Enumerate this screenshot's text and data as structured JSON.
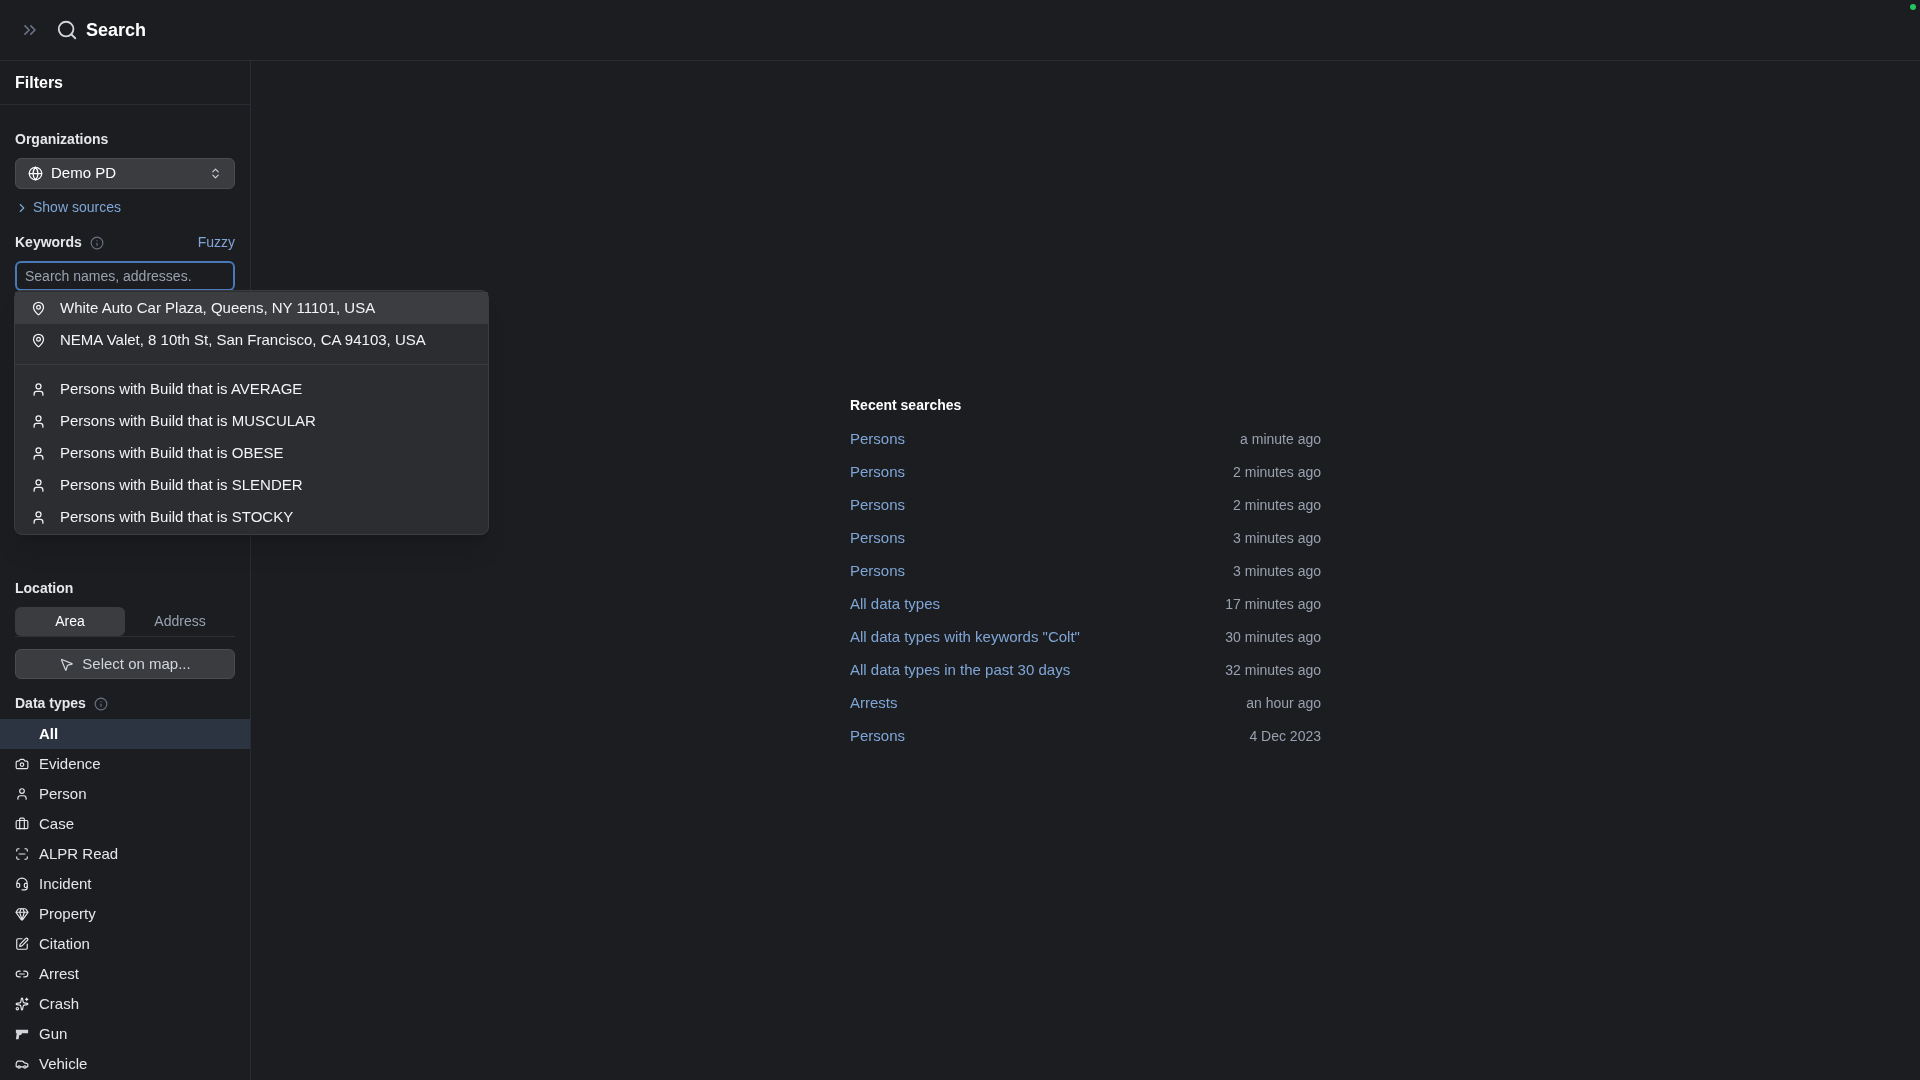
{
  "header": {
    "title": "Search"
  },
  "filters": {
    "title": "Filters",
    "organizations": {
      "label": "Organizations",
      "value": "Demo PD",
      "show_sources": "Show sources"
    },
    "keywords": {
      "label": "Keywords",
      "mode": "Fuzzy",
      "placeholder": "Search names, addresses."
    },
    "suggestions": [
      {
        "kind": "place",
        "text": "White Auto Car Plaza, Queens, NY 11101, USA",
        "selected": true
      },
      {
        "kind": "place",
        "text": "NEMA Valet, 8 10th St, San Francisco, CA 94103, USA",
        "selected": false
      },
      {
        "kind": "person",
        "text": "Persons with Build that is AVERAGE",
        "selected": false
      },
      {
        "kind": "person",
        "text": "Persons with Build that is MUSCULAR",
        "selected": false
      },
      {
        "kind": "person",
        "text": "Persons with Build that is OBESE",
        "selected": false
      },
      {
        "kind": "person",
        "text": "Persons with Build that is SLENDER",
        "selected": false
      },
      {
        "kind": "person",
        "text": "Persons with Build that is STOCKY",
        "selected": false
      }
    ],
    "location": {
      "label": "Location",
      "tabs": [
        {
          "label": "Area",
          "selected": true
        },
        {
          "label": "Address",
          "selected": false
        }
      ],
      "map_button": "Select on map..."
    },
    "data_types": {
      "label": "Data types",
      "items": [
        {
          "label": "All",
          "selected": true
        },
        {
          "label": "Evidence",
          "selected": false
        },
        {
          "label": "Person",
          "selected": false
        },
        {
          "label": "Case",
          "selected": false
        },
        {
          "label": "ALPR Read",
          "selected": false
        },
        {
          "label": "Incident",
          "selected": false
        },
        {
          "label": "Property",
          "selected": false
        },
        {
          "label": "Citation",
          "selected": false
        },
        {
          "label": "Arrest",
          "selected": false
        },
        {
          "label": "Crash",
          "selected": false
        },
        {
          "label": "Gun",
          "selected": false
        },
        {
          "label": "Vehicle",
          "selected": false
        }
      ]
    }
  },
  "recent_searches": {
    "title": "Recent searches",
    "items": [
      {
        "query": "Persons",
        "time": "a minute ago"
      },
      {
        "query": "Persons",
        "time": "2 minutes ago"
      },
      {
        "query": "Persons",
        "time": "2 minutes ago"
      },
      {
        "query": "Persons",
        "time": "3 minutes ago"
      },
      {
        "query": "Persons",
        "time": "3 minutes ago"
      },
      {
        "query": "All data types",
        "time": "17 minutes ago"
      },
      {
        "query": "All data types with keywords \"Colt\"",
        "time": "30 minutes ago"
      },
      {
        "query": "All data types in the past 30 days",
        "time": "32 minutes ago"
      },
      {
        "query": "Arrests",
        "time": "an hour ago"
      },
      {
        "query": "Persons",
        "time": "4 Dec 2023"
      }
    ]
  }
}
